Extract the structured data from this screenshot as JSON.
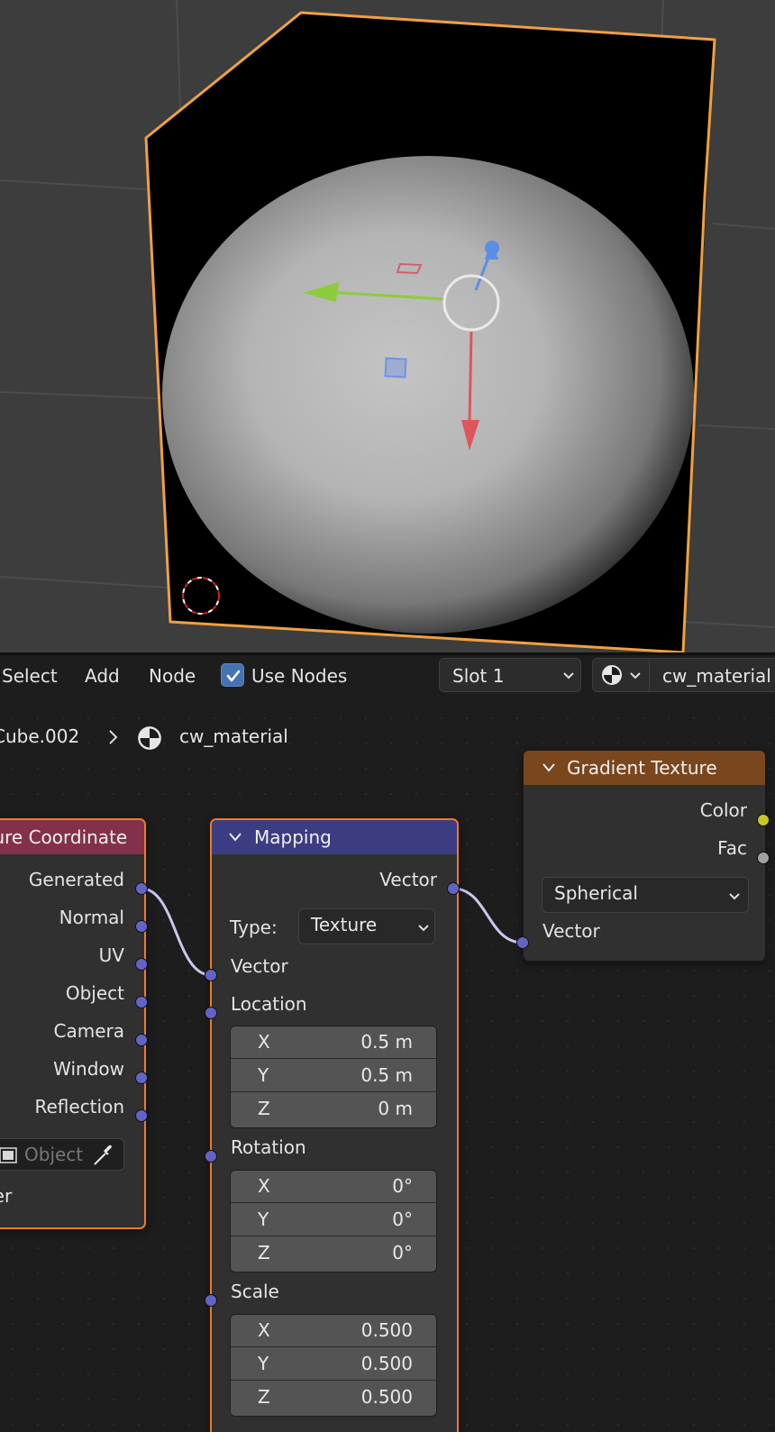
{
  "header": {
    "menu": [
      "Select",
      "Add",
      "Node"
    ],
    "use_nodes_label": "Use Nodes",
    "use_nodes_checked": true,
    "slot_value": "Slot 1",
    "material_name": "cw_material"
  },
  "breadcrumb": {
    "object": "Cube.002",
    "material": "cw_material"
  },
  "nodes": {
    "texture_coordinate": {
      "title": "Texture Coordinate",
      "outputs": [
        "Generated",
        "Normal",
        "UV",
        "Object",
        "Camera",
        "Window",
        "Reflection"
      ],
      "object_placeholder": "Object",
      "instancer_label": "From Instancer"
    },
    "mapping": {
      "title": "Mapping",
      "output_label": "Vector",
      "type_label": "Type:",
      "type_value": "Texture",
      "vector_input": "Vector",
      "location": {
        "label": "Location",
        "x": "0.5 m",
        "y": "0.5 m",
        "z": "0 m"
      },
      "rotation": {
        "label": "Rotation",
        "x": "0°",
        "y": "0°",
        "z": "0°"
      },
      "scale": {
        "label": "Scale",
        "x": "0.500",
        "y": "0.500",
        "z": "0.500"
      },
      "axes": [
        "X",
        "Y",
        "Z"
      ]
    },
    "gradient_texture": {
      "title": "Gradient Texture",
      "outputs": [
        "Color",
        "Fac"
      ],
      "gradient_type": "Spherical",
      "vector_input": "Vector"
    }
  },
  "colors": {
    "texcoord_header": "#83314a",
    "mapping_header": "#3c3c83",
    "gradient_header": "#79461d",
    "selection_outline": "#f0a040",
    "vector_socket": "#6363c7",
    "color_socket": "#c7c729",
    "fac_socket": "#a1a1a1"
  },
  "icons": [
    "checkmark-icon",
    "chevron-down-icon",
    "material-sphere-icon",
    "chevron-right-icon",
    "eyedropper-icon",
    "object-icon",
    "3d-cursor-icon",
    "transform-gizmo-icon"
  ]
}
